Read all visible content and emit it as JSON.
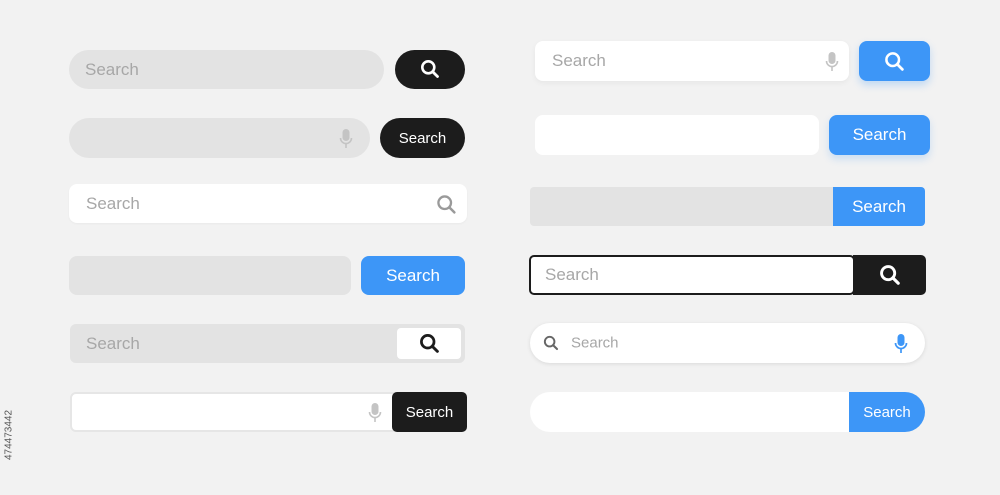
{
  "search_bars": [
    {
      "id": 1,
      "placeholder": "Search",
      "button_icon": "search-icon"
    },
    {
      "id": 2,
      "placeholder": "",
      "mic_icon": "microphone-icon",
      "button_label": "Search"
    },
    {
      "id": 3,
      "placeholder": "Search",
      "inline_icon": "search-icon"
    },
    {
      "id": 4,
      "placeholder": "",
      "button_label": "Search"
    },
    {
      "id": 5,
      "placeholder": "Search",
      "button_icon": "search-icon"
    },
    {
      "id": 6,
      "placeholder": "",
      "mic_icon": "microphone-icon",
      "button_label": "Search"
    },
    {
      "id": 7,
      "placeholder": "Search",
      "mic_icon": "microphone-icon",
      "button_icon": "search-icon"
    },
    {
      "id": 8,
      "placeholder": "",
      "button_label": "Search"
    },
    {
      "id": 9,
      "placeholder": "",
      "button_label": "Search"
    },
    {
      "id": 10,
      "placeholder": "Search",
      "button_icon": "search-icon"
    },
    {
      "id": 11,
      "placeholder": "Search",
      "leading_icon": "search-icon",
      "mic_icon": "microphone-icon"
    },
    {
      "id": 12,
      "placeholder": "",
      "button_label": "Search"
    }
  ],
  "stock_id": "474473442",
  "colors": {
    "background": "#f2f2f2",
    "field_gray": "#e3e3e3",
    "field_white": "#ffffff",
    "dark": "#1c1c1c",
    "blue": "#3d96f7",
    "placeholder": "#a7a7a7"
  }
}
